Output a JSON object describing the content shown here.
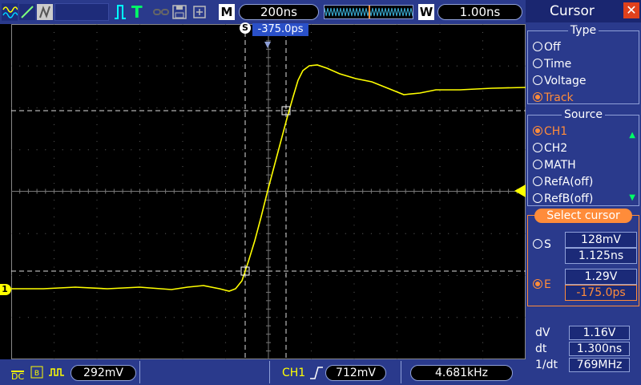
{
  "top": {
    "mode_label": "M",
    "timebase": "200ns",
    "window_label": "W",
    "window_timebase": "1.00ns"
  },
  "screen": {
    "cursor_s_label": "S",
    "delay_readout": "-375.0ps",
    "ch1_marker": "1"
  },
  "bottom": {
    "coupling": "DC",
    "ch1_scale": "292mV",
    "trigger_source": "CH1",
    "trigger_level": "712mV",
    "frequency": "4.681kHz"
  },
  "panel": {
    "title": "Cursor",
    "close_glyph": "✕",
    "type_group": {
      "title": "Type",
      "options": [
        "Off",
        "Time",
        "Voltage",
        "Track"
      ],
      "selected": "Track"
    },
    "source_group": {
      "title": "Source",
      "options": [
        "CH1",
        "CH2",
        "MATH",
        "RefA(off)",
        "RefB(off)"
      ],
      "selected": "CH1"
    },
    "select_group": {
      "title": "Select cursor",
      "s_label": "S",
      "s_voltage": "128mV",
      "s_time": "1.125ns",
      "e_label": "E",
      "e_voltage": "1.29V",
      "e_time": "-175.0ps"
    },
    "readouts": {
      "dv_label": "dV",
      "dv_value": "1.16V",
      "dt_label": "dt",
      "dt_value": "1.300ns",
      "inv_dt_label": "1/dt",
      "inv_dt_value": "769MHz"
    }
  },
  "colors": {
    "trace": "#ffff00",
    "accent": "#ff8c3a",
    "bar": "#2a3a8c"
  }
}
